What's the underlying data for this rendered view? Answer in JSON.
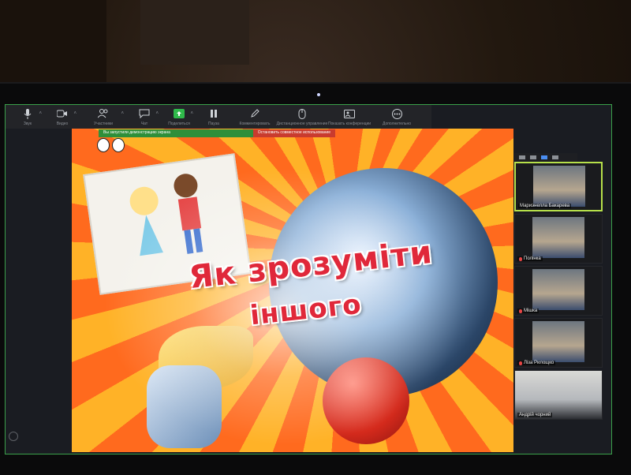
{
  "toolbar": {
    "buttons": [
      {
        "label": "Звук",
        "icon": "microphone-icon"
      },
      {
        "label": "Видео",
        "icon": "video-camera-icon"
      },
      {
        "label": "Участники",
        "icon": "participants-icon"
      },
      {
        "label": "Чат",
        "icon": "chat-icon"
      },
      {
        "label": "Поделиться",
        "icon": "share-arrow-icon"
      },
      {
        "label": "Пауза",
        "icon": "pause-icon"
      },
      {
        "label": "Комментировать",
        "icon": "pencil-icon"
      },
      {
        "label": "Дистанционное управление",
        "icon": "mouse-icon"
      },
      {
        "label": "Показать конференции",
        "icon": "screen-icon"
      },
      {
        "label": "Дополнительно",
        "icon": "more-icon"
      }
    ]
  },
  "share_bar": {
    "status": "Вы запустили демонстрацию экрана",
    "stop": "Остановить совместное использование"
  },
  "slide": {
    "title_line1": "Як зрозуміти",
    "title_line2": "іншого"
  },
  "participants": [
    {
      "name": "Мариэнелла Бакарева",
      "muted": false,
      "active": true
    },
    {
      "name": "Полінка",
      "muted": true,
      "active": false
    },
    {
      "name": "Мішка",
      "muted": true,
      "active": false
    },
    {
      "name": "Ліза Рилощко",
      "muted": true,
      "active": false
    },
    {
      "name": "Андрій чорний",
      "muted": false,
      "active": false
    }
  ],
  "colors": {
    "share_green": "#2f8f3a",
    "stop_red": "#c93b2e",
    "active_speaker": "#b6e04a",
    "title_red": "#e0283a"
  }
}
